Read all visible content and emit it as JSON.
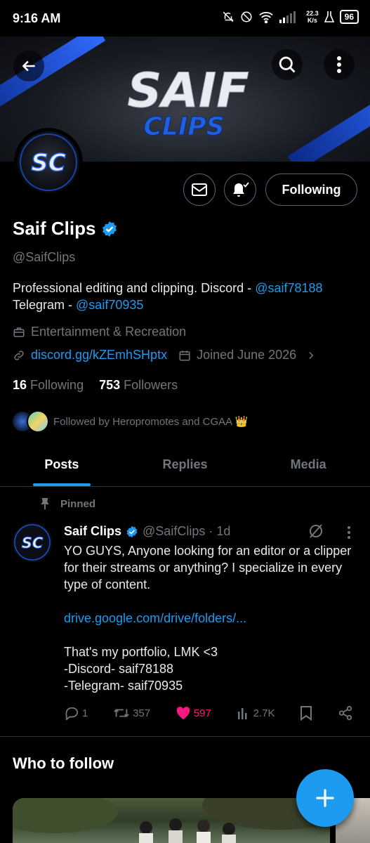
{
  "status_bar": {
    "time": "9:16 AM",
    "speed_top": "22.3",
    "speed_bottom": "K/s",
    "battery": "96"
  },
  "banner": {
    "logo_line1": "SAIF",
    "logo_line2": "CLIPS"
  },
  "avatar": {
    "initials": "SC"
  },
  "profile": {
    "name": "Saif Clips",
    "handle": "@SaifClips",
    "bio_text1": "Professional editing and clipping. Discord - ",
    "bio_mention1": "@saif78188",
    "bio_text2": "Telegram - ",
    "bio_mention2": "@saif70935",
    "category": "Entertainment & Recreation",
    "website": "discord.gg/kZEmhSHptx",
    "joined": "Joined June 2026",
    "following_count": "16",
    "following_label": "Following",
    "followers_count": "753",
    "followers_label": "Followers",
    "followed_by": "Followed by Heropromotes and CGAA 👑"
  },
  "buttons": {
    "following": "Following"
  },
  "tabs": [
    {
      "label": "Posts",
      "active": true
    },
    {
      "label": "Replies",
      "active": false
    },
    {
      "label": "Media",
      "active": false
    }
  ],
  "post": {
    "pinned_label": "Pinned",
    "author": "Saif Clips",
    "handle_time": "@SaifClips · 1d",
    "text1": "YO GUYS, Anyone looking for an editor or a clipper for their streams or anything? I specialize in every type of content.",
    "link": "drive.google.com/drive/folders/...",
    "text2": "That's my portfolio, LMK <3\n-Discord- saif78188\n-Telegram- saif70935",
    "replies": "1",
    "reposts": "357",
    "likes": "597",
    "views": "2.7K"
  },
  "who_to_follow": "Who to follow",
  "colors": {
    "accent": "#1d9bf0",
    "like": "#f91880",
    "muted": "#71767b"
  }
}
